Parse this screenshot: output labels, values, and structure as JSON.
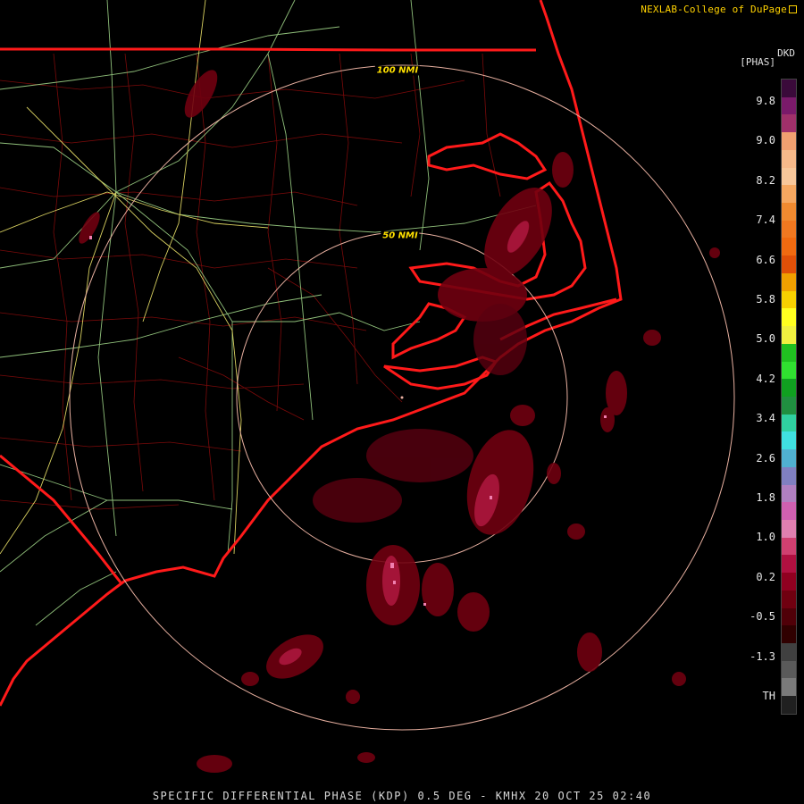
{
  "credit": "NEXLAB-College of DuPage",
  "product_label": "DKD",
  "unit_label": "[PHAS]",
  "legend": {
    "labels": [
      "9.8",
      "9.0",
      "8.2",
      "7.4",
      "6.6",
      "5.8",
      "5.0",
      "4.2",
      "3.4",
      "2.6",
      "1.8",
      "1.0",
      "0.2",
      "-0.5",
      "-1.3",
      "TH"
    ],
    "colors": [
      "#3a0a3a",
      "#7a1a6a",
      "#a0306a",
      "#f0a070",
      "#f6b98a",
      "#f7c79a",
      "#f5a760",
      "#f08a30",
      "#f07820",
      "#f06a10",
      "#e05008",
      "#f0a000",
      "#f8d000",
      "#ffff20",
      "#f0f040",
      "#20c020",
      "#30e030",
      "#10a020",
      "#208f40",
      "#30d0a0",
      "#40e0e0",
      "#50b0d0",
      "#8080c0",
      "#b080c0",
      "#d060b0",
      "#e080b0",
      "#d04070",
      "#b01040",
      "#900020",
      "#700010",
      "#500008",
      "#300000",
      "#404040",
      "#5a5a5a",
      "#7a7a7a",
      "#202020"
    ]
  },
  "rings": [
    {
      "label": "50 NMI"
    },
    {
      "label": "100 NMI"
    }
  ],
  "footer": "SPECIFIC DIFFERENTIAL PHASE (KDP) 0.5 DEG - KMHX 20 OCT 25 02:40"
}
